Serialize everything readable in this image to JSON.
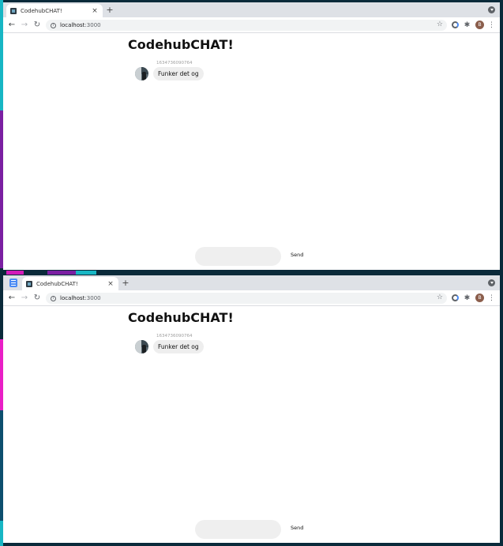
{
  "windows": [
    {
      "tab_title": "CodehubCHAT!",
      "tab_close": "×",
      "new_tab": "+",
      "url_host": "localhost",
      "url_port": ":3000",
      "avatar_letter": "B",
      "page": {
        "title": "CodehubCHAT!",
        "messages": [
          {
            "timestamp": "1634736090764",
            "text": "Funker det og"
          }
        ],
        "input_placeholder": "",
        "send_label": "Send"
      }
    },
    {
      "tab_title": "CodehubCHAT!",
      "tab_close": "×",
      "new_tab": "+",
      "url_host": "localhost",
      "url_port": ":3000",
      "avatar_letter": "B",
      "page": {
        "title": "CodehubCHAT!",
        "messages": [
          {
            "timestamp": "1634736090764",
            "text": "Funker det og"
          }
        ],
        "input_placeholder": "",
        "send_label": "Send"
      }
    }
  ],
  "icons": {
    "back": "←",
    "forward": "→",
    "reload": "↻",
    "info": "i",
    "star": "☆",
    "puzzle": "✱",
    "menu": "⋮"
  },
  "colors": {
    "tabstrip": "#dee1e6",
    "omnibox": "#f1f3f4",
    "bubble": "#eeeeee",
    "avatar": "#8b5e4c"
  }
}
